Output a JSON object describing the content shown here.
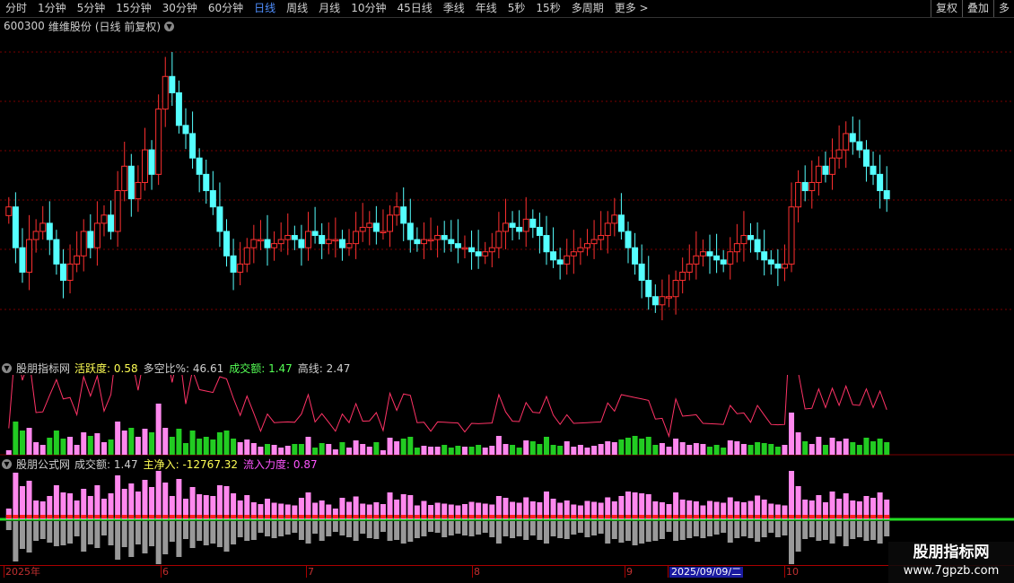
{
  "toolbar": {
    "tabs": [
      "分时",
      "1分钟",
      "5分钟",
      "15分钟",
      "30分钟",
      "60分钟",
      "日线",
      "周线",
      "月线",
      "10分钟",
      "45日线",
      "季线",
      "年线",
      "5秒",
      "15秒",
      "多周期",
      "更多 >"
    ],
    "active_tab": "日线",
    "right_buttons": [
      "复权",
      "叠加",
      "多"
    ]
  },
  "security": {
    "code": "600300",
    "name": "维维股份",
    "mode": "(日线 前复权)"
  },
  "indicator1": {
    "name": "股朋指标网",
    "items": [
      {
        "label": "活跃度: 0.58",
        "color": "#ffff55"
      },
      {
        "label": "多空比%: 46.61",
        "color": "#cfcfcf"
      },
      {
        "label": "成交额: 1.47",
        "color": "#55ff55"
      },
      {
        "label": "高线: 2.47",
        "color": "#cfcfcf"
      }
    ]
  },
  "indicator2": {
    "name": "股朋公式网",
    "items": [
      {
        "label": "成交额: 1.47",
        "color": "#cfcfcf"
      },
      {
        "label": "主净入: -12767.32",
        "color": "#ffff55"
      },
      {
        "label": "流入力度: 0.87",
        "color": "#ff55ff"
      }
    ]
  },
  "time_axis": {
    "labels": [
      "2025年",
      "6",
      "7",
      "8",
      "9",
      "2025/09/09/二",
      "10"
    ],
    "selected": "2025/09/09/二"
  },
  "watermark": {
    "title": "股朋指标网",
    "url": "www.7gpzb.com"
  },
  "colors": {
    "up": "#ff3030",
    "down": "#55ffff",
    "grid": "#7a0000",
    "vol_green": "#22cc22",
    "vol_pink": "#ff88ee",
    "flow_red": "#ff2020",
    "flow_gray": "#999999"
  },
  "chart_data": {
    "type": "candlestick",
    "series_close": [
      5.3,
      4.8,
      4.5,
      4.9,
      5.0,
      5.1,
      4.9,
      4.6,
      4.4,
      4.6,
      4.7,
      5.0,
      4.8,
      5.1,
      5.2,
      5.0,
      5.5,
      5.8,
      5.4,
      5.6,
      6.0,
      5.7,
      6.5,
      6.9,
      6.7,
      6.3,
      6.2,
      5.9,
      5.7,
      5.5,
      5.3,
      5.0,
      4.7,
      4.5,
      4.6,
      4.8,
      4.9,
      4.9,
      4.8,
      4.85,
      4.9,
      4.95,
      4.9,
      4.8,
      5.0,
      4.95,
      4.85,
      4.9,
      4.9,
      4.8,
      4.85,
      5.0,
      5.05,
      5.1,
      5.0,
      5.0,
      5.2,
      5.3,
      5.1,
      4.9,
      4.85,
      4.9,
      4.9,
      4.95,
      4.9,
      4.85,
      4.8,
      4.8,
      4.75,
      4.7,
      4.75,
      4.8,
      5.0,
      5.1,
      5.05,
      5.0,
      5.15,
      5.05,
      4.95,
      4.75,
      4.65,
      4.6,
      4.7,
      4.75,
      4.8,
      4.85,
      4.9,
      4.95,
      5.1,
      5.2,
      5.0,
      4.8,
      4.6,
      4.4,
      4.2,
      4.1,
      4.2,
      4.2,
      4.4,
      4.5,
      4.6,
      4.7,
      4.75,
      4.7,
      4.65,
      4.6,
      4.75,
      4.85,
      4.95,
      4.9,
      4.75,
      4.65,
      4.6,
      4.55,
      4.6,
      5.3,
      5.6,
      5.5,
      5.6,
      5.8,
      5.7,
      5.9,
      6.0,
      6.2,
      6.1,
      6.0,
      5.8,
      5.7,
      5.5,
      5.4
    ]
  }
}
